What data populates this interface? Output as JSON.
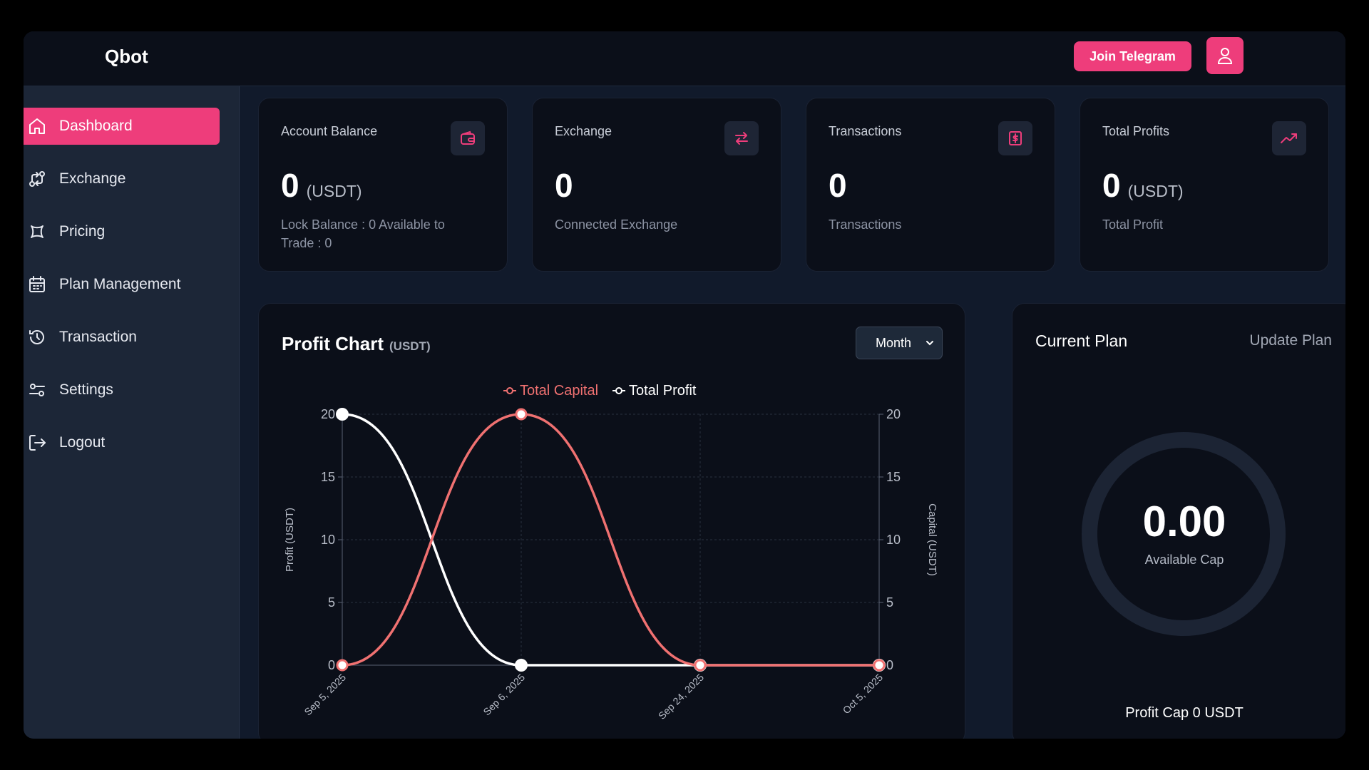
{
  "app": {
    "brand": "Qbot"
  },
  "header": {
    "telegram_label": "Join Telegram"
  },
  "sidebar": {
    "items": [
      {
        "label": "Dashboard",
        "icon": "home-icon",
        "active": true
      },
      {
        "label": "Exchange",
        "icon": "exchange-icon",
        "active": false
      },
      {
        "label": "Pricing",
        "icon": "pricing-icon",
        "active": false
      },
      {
        "label": "Plan Management",
        "icon": "calendar-icon",
        "active": false
      },
      {
        "label": "Transaction",
        "icon": "history-icon",
        "active": false
      },
      {
        "label": "Settings",
        "icon": "sliders-icon",
        "active": false
      },
      {
        "label": "Logout",
        "icon": "logout-icon",
        "active": false
      }
    ]
  },
  "cards": [
    {
      "title": "Account Balance",
      "value": "0",
      "unit": "(USDT)",
      "sub": "Lock Balance : 0 Available to Trade : 0",
      "icon": "wallet-icon"
    },
    {
      "title": "Exchange",
      "value": "0",
      "unit": "",
      "sub": "Connected Exchange",
      "icon": "swap-icon"
    },
    {
      "title": "Transactions",
      "value": "0",
      "unit": "",
      "sub": "Transactions",
      "icon": "dollar-doc-icon"
    },
    {
      "title": "Total Profits",
      "value": "0",
      "unit": "(USDT)",
      "sub": "Total Profit",
      "icon": "trending-up-icon"
    }
  ],
  "profit_chart": {
    "title": "Profit Chart",
    "unit": "(USDT)",
    "period": "Month"
  },
  "chart_data": {
    "type": "line",
    "categories": [
      "Sep 5, 2025",
      "Sep 6, 2025",
      "Sep 24, 2025",
      "Oct 5, 2025"
    ],
    "series": [
      {
        "name": "Total Capital",
        "axis": "right",
        "color": "#f07171",
        "values": [
          0,
          20,
          0,
          0
        ]
      },
      {
        "name": "Total Profit",
        "axis": "left",
        "color": "#ffffff",
        "values": [
          20,
          0,
          0,
          0
        ]
      }
    ],
    "ylabel": "Profit (USDT)",
    "y2label": "Capital (USDT)",
    "ylim": [
      0,
      20
    ],
    "y2lim": [
      0,
      20
    ],
    "yticks": [
      0,
      5,
      10,
      15,
      20
    ],
    "grid": true,
    "legend": "top-center"
  },
  "plan": {
    "title": "Current Plan",
    "update_label": "Update Plan",
    "value": "0.00",
    "caption": "Available Cap",
    "profit_cap": "Profit Cap 0 USDT"
  },
  "colors": {
    "accent": "#ee3d7b",
    "background": "#111a2b",
    "card": "#0b0f19",
    "sidebar": "#1c2637"
  }
}
